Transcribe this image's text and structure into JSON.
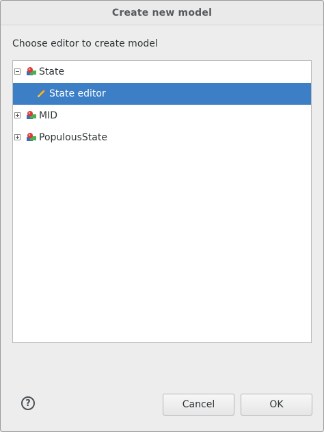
{
  "window": {
    "title": "Create new model"
  },
  "prompt": "Choose editor to create model",
  "tree": {
    "nodes": [
      {
        "label": "State",
        "expanded": true,
        "icon": "model-icon",
        "children": [
          {
            "label": "State editor",
            "icon": "pencil-icon",
            "selected": true
          }
        ]
      },
      {
        "label": "MID",
        "expanded": false,
        "icon": "model-icon"
      },
      {
        "label": "PopulousState",
        "expanded": false,
        "icon": "model-icon"
      }
    ]
  },
  "buttons": {
    "help_icon": "question-mark",
    "cancel_label": "Cancel",
    "ok_label": "OK"
  },
  "colors": {
    "selection": "#3d7fc6",
    "background": "#ededed"
  }
}
